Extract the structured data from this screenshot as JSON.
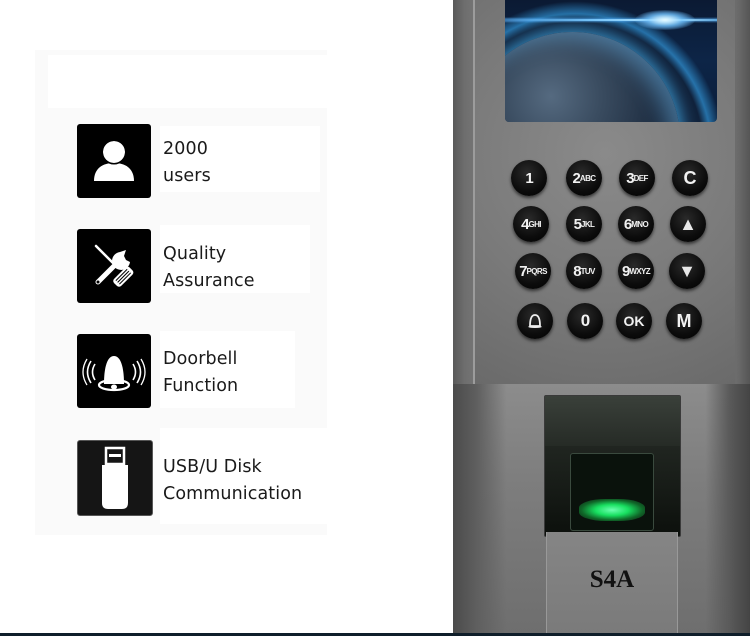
{
  "features": [
    {
      "icon": "user-icon",
      "lines": [
        "2000",
        "users"
      ]
    },
    {
      "icon": "tools-icon",
      "lines": [
        "Quality",
        "Assurance"
      ]
    },
    {
      "icon": "doorbell-icon",
      "lines": [
        "Doorbell",
        "Function"
      ]
    },
    {
      "icon": "usb-drive-icon",
      "lines": [
        "USB/U Disk",
        "Communication"
      ]
    }
  ],
  "device": {
    "model": "S4A",
    "keypad": [
      [
        {
          "main": "1",
          "sub": ""
        },
        {
          "main": "2",
          "sub": "ABC"
        },
        {
          "main": "3",
          "sub": "DEF"
        },
        {
          "main": "C",
          "sub": ""
        }
      ],
      [
        {
          "main": "4",
          "sub": "GHI"
        },
        {
          "main": "5",
          "sub": "JKL"
        },
        {
          "main": "6",
          "sub": "MNO"
        },
        {
          "main": "▲",
          "sub": ""
        }
      ],
      [
        {
          "main": "7",
          "sub": "PQRS"
        },
        {
          "main": "8",
          "sub": "TUV"
        },
        {
          "main": "9",
          "sub": "WXYZ"
        },
        {
          "main": "▼",
          "sub": ""
        }
      ],
      [
        {
          "main": "bell",
          "sub": ""
        },
        {
          "main": "0",
          "sub": ""
        },
        {
          "main": "OK",
          "sub": ""
        },
        {
          "main": "M",
          "sub": ""
        }
      ]
    ],
    "fingerprint_led_color": "#18e060",
    "screen_image": "earth-from-space"
  }
}
